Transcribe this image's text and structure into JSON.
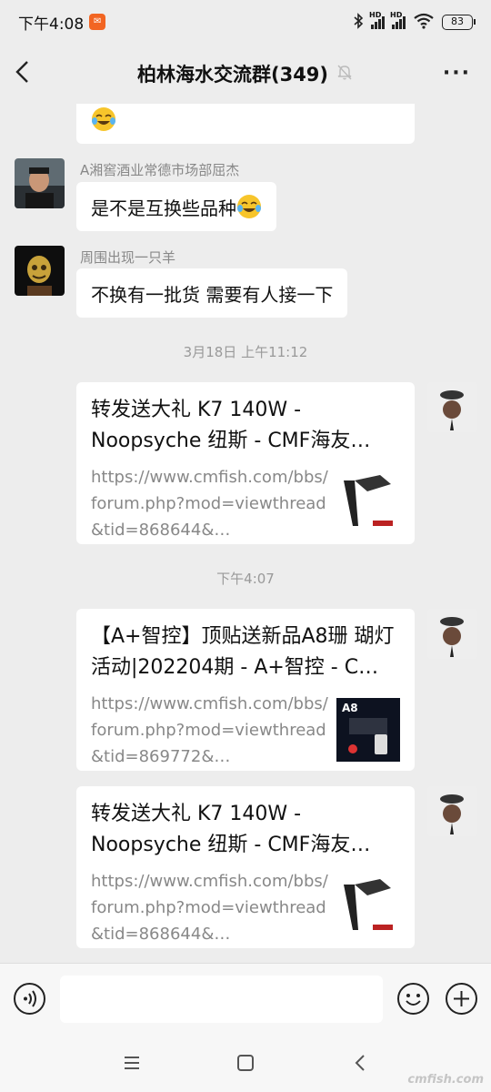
{
  "status": {
    "time": "下午4:08",
    "battery": "83",
    "hd1": "HD",
    "hd2": "HD"
  },
  "header": {
    "title": "柏林海水交流群(349)",
    "more": "···"
  },
  "messages": [
    {
      "type": "text",
      "sender": "",
      "text": ""
    },
    {
      "type": "text",
      "sender": "A湘窖酒业常德市场部屈杰",
      "text": "是不是互换些品种"
    },
    {
      "type": "text",
      "sender": "周围出现一只羊",
      "text": "不换有一批货 需要有人接一下"
    }
  ],
  "timestamps": [
    "3月18日 上午11:12",
    "下午4:07"
  ],
  "links": [
    {
      "title": "转发送大礼 K7 140W - Noopsyche 纽斯 - CMF海友…",
      "url": "https://www.cmfish.com/bbs/forum.php?mod=viewthread&tid=868644&…"
    },
    {
      "title": "【A+智控】顶贴送新品A8珊 瑚灯活动|202204期 - A+智控 - C…",
      "url": "https://www.cmfish.com/bbs/forum.php?mod=viewthread&tid=869772&…",
      "thumb_label": "A8"
    },
    {
      "title": "转发送大礼 K7 140W - Noopsyche 纽斯 - CMF海友…",
      "url": "https://www.cmfish.com/bbs/forum.php?mod=viewthread&tid=868644&…"
    }
  ],
  "input": {
    "placeholder": ""
  },
  "watermark": "cmfish.com",
  "colors": {
    "background": "#ededed",
    "bubble": "#ffffff",
    "accent_status_app": "#f26522"
  }
}
